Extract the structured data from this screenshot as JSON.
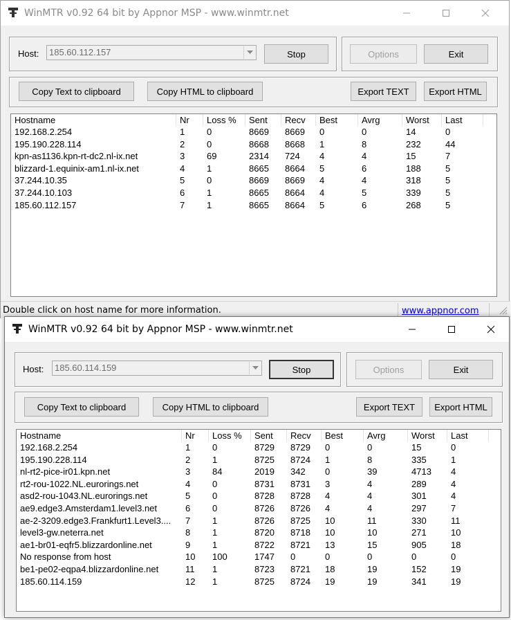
{
  "columns": [
    "Hostname",
    "Nr",
    "Loss %",
    "Sent",
    "Recv",
    "Best",
    "Avrg",
    "Worst",
    "Last"
  ],
  "status": {
    "hint": "Double click on host name for more information.",
    "link": "www.appnor.com"
  },
  "window1": {
    "title": "WinMTR v0.92 64 bit by Appnor MSP - www.winmtr.net",
    "host_label": "Host:",
    "host_value": "185.60.112.157",
    "stop_label": "Stop",
    "options_label": "Options",
    "exit_label": "Exit",
    "copy_text_label": "Copy Text to clipboard",
    "copy_html_label": "Copy HTML to clipboard",
    "export_text_label": "Export TEXT",
    "export_html_label": "Export HTML",
    "rows": [
      [
        "192.168.2.254",
        "1",
        "0",
        "8669",
        "8669",
        "0",
        "0",
        "14",
        "0"
      ],
      [
        "195.190.228.114",
        "2",
        "0",
        "8668",
        "8668",
        "1",
        "8",
        "232",
        "44"
      ],
      [
        "kpn-as1136.kpn-rt-dc2.nl-ix.net",
        "3",
        "69",
        "2314",
        "724",
        "4",
        "4",
        "15",
        "7"
      ],
      [
        "blizzard-1.equinix-am1.nl-ix.net",
        "4",
        "1",
        "8665",
        "8664",
        "5",
        "6",
        "188",
        "5"
      ],
      [
        "37.244.10.35",
        "5",
        "0",
        "8669",
        "8669",
        "4",
        "4",
        "318",
        "5"
      ],
      [
        "37.244.10.103",
        "6",
        "1",
        "8665",
        "8664",
        "4",
        "5",
        "339",
        "5"
      ],
      [
        "185.60.112.157",
        "7",
        "1",
        "8665",
        "8664",
        "5",
        "6",
        "268",
        "5"
      ]
    ]
  },
  "window2": {
    "title": "WinMTR v0.92 64 bit by Appnor MSP - www.winmtr.net",
    "host_label": "Host:",
    "host_value": "185.60.114.159",
    "stop_label": "Stop",
    "options_label": "Options",
    "exit_label": "Exit",
    "copy_text_label": "Copy Text to clipboard",
    "copy_html_label": "Copy HTML to clipboard",
    "export_text_label": "Export TEXT",
    "export_html_label": "Export HTML",
    "rows": [
      [
        "192.168.2.254",
        "1",
        "0",
        "8729",
        "8729",
        "0",
        "0",
        "15",
        "0"
      ],
      [
        "195.190.228.114",
        "2",
        "1",
        "8725",
        "8724",
        "1",
        "8",
        "335",
        "1"
      ],
      [
        "nl-rt2-pice-ir01.kpn.net",
        "3",
        "84",
        "2019",
        "342",
        "0",
        "39",
        "4713",
        "4"
      ],
      [
        "rt2-rou-1022.NL.eurorings.net",
        "4",
        "0",
        "8731",
        "8731",
        "3",
        "4",
        "289",
        "4"
      ],
      [
        "asd2-rou-1043.NL.eurorings.net",
        "5",
        "0",
        "8728",
        "8728",
        "4",
        "4",
        "301",
        "4"
      ],
      [
        "ae9.edge3.Amsterdam1.level3.net",
        "6",
        "0",
        "8726",
        "8726",
        "4",
        "4",
        "297",
        "7"
      ],
      [
        "ae-2-3209.edge3.Frankfurt1.Level3....",
        "7",
        "1",
        "8726",
        "8725",
        "10",
        "11",
        "330",
        "11"
      ],
      [
        "level3-gw.neterra.net",
        "8",
        "1",
        "8720",
        "8718",
        "10",
        "10",
        "271",
        "10"
      ],
      [
        "ae1-br01-eqfr5.blizzardonline.net",
        "9",
        "1",
        "8722",
        "8721",
        "13",
        "15",
        "905",
        "18"
      ],
      [
        "No response from host",
        "10",
        "100",
        "1747",
        "0",
        "0",
        "0",
        "0",
        "0"
      ],
      [
        "be1-pe02-eqpa4.blizzardonline.net",
        "11",
        "1",
        "8723",
        "8721",
        "18",
        "19",
        "152",
        "19"
      ],
      [
        "185.60.114.159",
        "12",
        "1",
        "8725",
        "8724",
        "19",
        "19",
        "341",
        "19"
      ]
    ]
  }
}
